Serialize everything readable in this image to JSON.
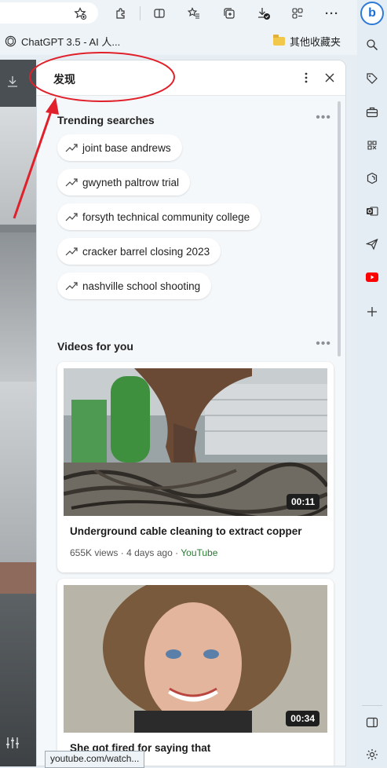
{
  "toolbar": {
    "icons": [
      "star-add-icon",
      "extensions-icon",
      "split-screen-icon",
      "favorites-icon",
      "collections-icon",
      "downloads-icon",
      "performance-icon",
      "more-icon",
      "bing-icon"
    ]
  },
  "favorites_bar": {
    "items": [
      {
        "label": "ChatGPT 3.5 - AI 人...",
        "icon": "chatgpt-icon"
      },
      {
        "label": "其他收藏夹",
        "icon": "folder-icon"
      }
    ]
  },
  "panel": {
    "title": "发现",
    "trending": {
      "title": "Trending searches",
      "items": [
        "joint base andrews",
        "gwyneth paltrow trial",
        "forsyth technical community college",
        "cracker barrel closing 2023",
        "nashville school shooting"
      ]
    },
    "videos": {
      "title": "Videos for you",
      "items": [
        {
          "title": "Underground cable cleaning to extract copper",
          "views": "655K views",
          "age": "4 days ago",
          "source": "YouTube",
          "duration": "00:11"
        },
        {
          "title": "She got fired for saying that",
          "views": "",
          "age": "",
          "source": "",
          "duration": "00:34"
        }
      ]
    }
  },
  "status_bar": {
    "url": "youtube.com/watch..."
  },
  "sidebar": {
    "icons": [
      "search-icon",
      "shopping-tag-icon",
      "tools-icon",
      "games-icon",
      "microsoft365-icon",
      "outlook-icon",
      "send-icon",
      "youtube-icon",
      "add-icon",
      "split-panel-icon",
      "settings-icon"
    ]
  },
  "colors": {
    "accent": "#1a6fd6",
    "annotation": "#e0202a",
    "youtube": "#ff0000"
  }
}
